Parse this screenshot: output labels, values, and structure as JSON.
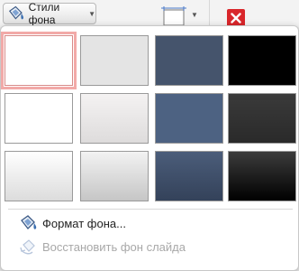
{
  "toolbar": {
    "background_styles_label": "Стили фона",
    "icons": {
      "background_styles": "paint-bucket-icon",
      "layout": "slide-layout-icon",
      "close": "close-icon"
    },
    "colors": {
      "close_bg": "#d9262b"
    }
  },
  "gallery": {
    "selected_index": 0,
    "swatches": [
      {
        "name": "style-1",
        "fill": "#ffffff"
      },
      {
        "name": "style-2",
        "fill": "#e4e4e4"
      },
      {
        "name": "style-3",
        "fill": "#45546c"
      },
      {
        "name": "style-4",
        "fill": "#000000"
      },
      {
        "name": "style-5",
        "fill": "#ffffff"
      },
      {
        "name": "style-6",
        "fill": "linear-gradient(#f4f2f2, #dedcdc)"
      },
      {
        "name": "style-7",
        "fill": "#4d6282"
      },
      {
        "name": "style-8",
        "fill": "linear-gradient(#3a3a3a, #2a2a2a)"
      },
      {
        "name": "style-9",
        "fill": "linear-gradient(#ffffff, #dcdcdc)"
      },
      {
        "name": "style-10",
        "fill": "linear-gradient(#f2f2f2, #c6c6c6)"
      },
      {
        "name": "style-11",
        "fill": "linear-gradient(#4b5d7a, #34425a)"
      },
      {
        "name": "style-12",
        "fill": "linear-gradient(#3c3c3c, #000000)"
      }
    ]
  },
  "menu": {
    "format_background": {
      "label": "Формат фона...",
      "icon": "format-background-icon",
      "enabled": true
    },
    "reset_background": {
      "label": "Восстановить фон слайда",
      "icon": "reset-background-icon",
      "enabled": false
    }
  }
}
